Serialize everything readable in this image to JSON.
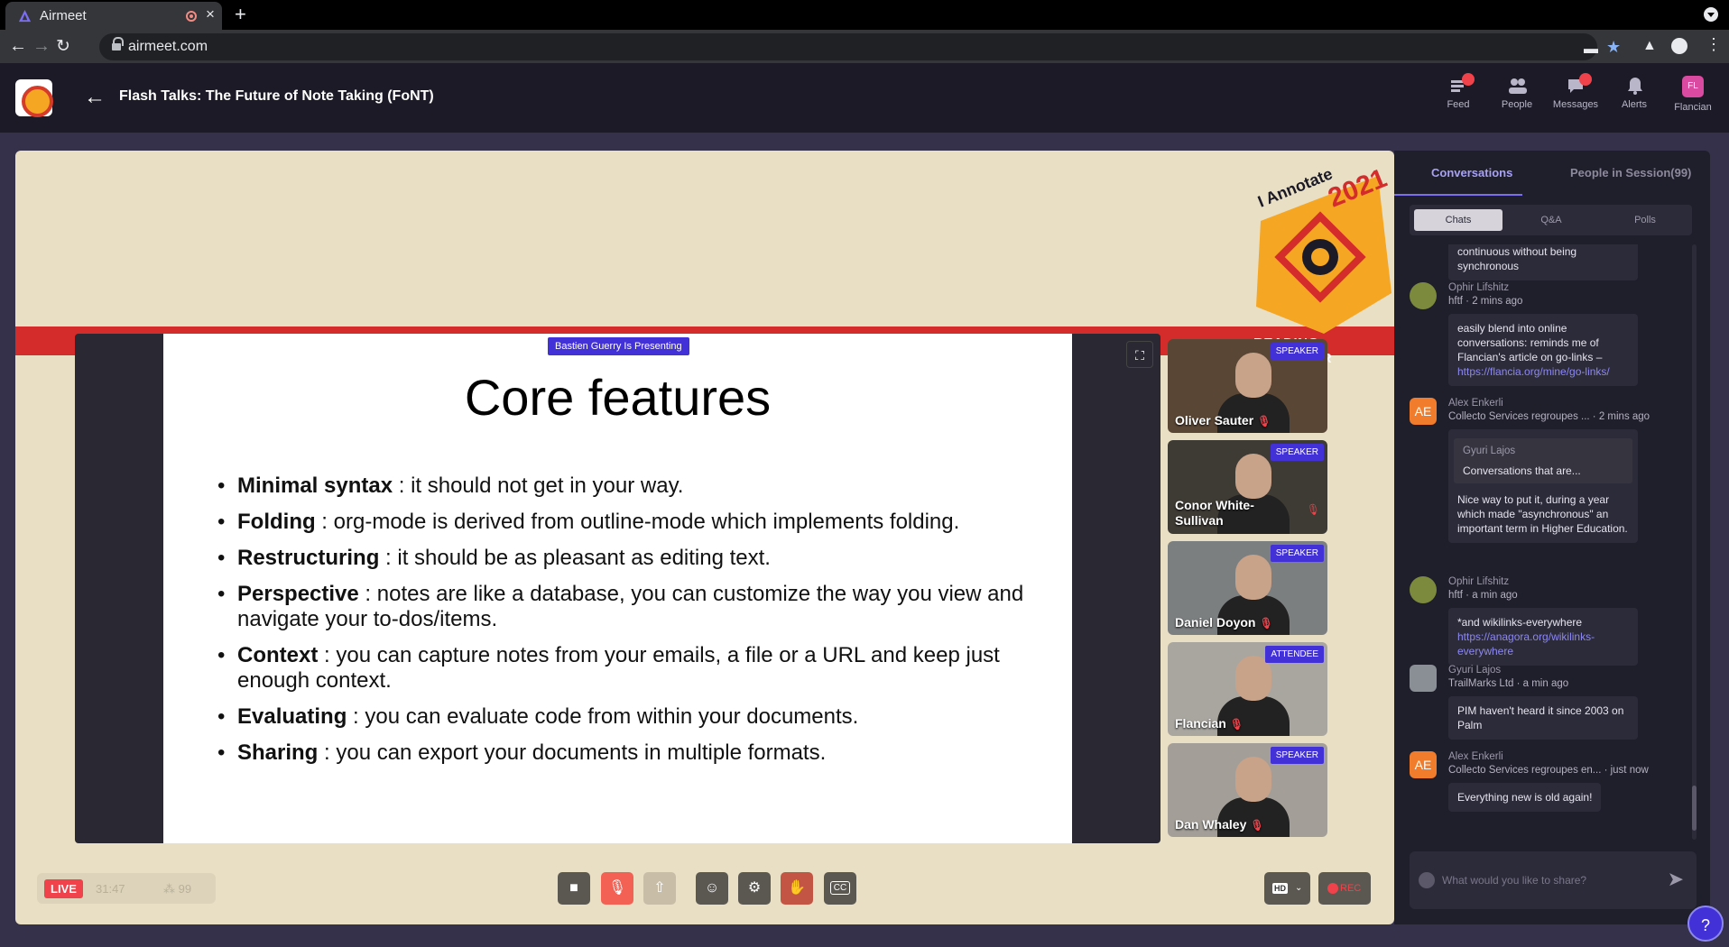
{
  "browser": {
    "tab_title": "Airmeet",
    "url": "airmeet.com"
  },
  "header": {
    "session_title": "Flash Talks: The Future of Note Taking (FoNT)",
    "nav": [
      {
        "label": "Feed",
        "icon": "feed-icon",
        "has_dot": true
      },
      {
        "label": "People",
        "icon": "people-icon",
        "has_dot": false
      },
      {
        "label": "Messages",
        "icon": "messages-icon",
        "has_dot": true
      },
      {
        "label": "Alerts",
        "icon": "bell-icon",
        "has_dot": false
      },
      {
        "label": "Flancian",
        "icon": "avatar",
        "has_dot": false
      }
    ],
    "user_initials": "FL"
  },
  "stage": {
    "banner_badge": "I Annotate 2021",
    "banner_text": "READING TOGETHER",
    "presenting_label": "Bastien Guerry Is Presenting",
    "slide": {
      "title": "Core features",
      "bullets": [
        {
          "term": "Minimal syntax",
          "text": " : it should not get in your way."
        },
        {
          "term": "Folding",
          "text": " : org-mode is derived from outline-mode which implements folding."
        },
        {
          "term": "Restructuring",
          "text": " : it should be as pleasant as editing text."
        },
        {
          "term": "Perspective",
          "text": " : notes are like a database, you can customize the way you view and navigate your to-dos/items."
        },
        {
          "term": "Context",
          "text": " : you can capture notes from your emails, a file or a URL and keep just enough context."
        },
        {
          "term": "Evaluating",
          "text": " : you can evaluate code from within your documents."
        },
        {
          "term": "Sharing",
          "text": " : you can export your documents in multiple formats."
        }
      ]
    },
    "tiles": [
      {
        "name": "Oliver Sauter",
        "role": "SPEAKER",
        "bg": "#5a4634"
      },
      {
        "name": "Conor White-Sullivan",
        "role": "SPEAKER",
        "bg": "#3e3a34"
      },
      {
        "name": "Daniel Doyon",
        "role": "SPEAKER",
        "bg": "#7c7f80"
      },
      {
        "name": "Flancian",
        "role": "ATTENDEE",
        "bg": "#a9a6a0"
      },
      {
        "name": "Dan Whaley",
        "role": "SPEAKER",
        "bg": "#a39f98"
      }
    ]
  },
  "controls": {
    "live_label": "LIVE",
    "timer": "31:47",
    "attendee_count": "99",
    "hd_label": "HD",
    "rec_label": "REC"
  },
  "panel": {
    "tabs": [
      "Conversations",
      "People in Session(99)"
    ],
    "subtabs": [
      "Chats",
      "Q&A",
      "Polls"
    ],
    "messages": [
      {
        "partial_text": "continuous without being synchronous"
      },
      {
        "author": "Ophir Lifshitz",
        "meta": "hftf · 2 mins ago",
        "text": "easily blend into online conversations: reminds me of Flancian's article on go-links – ",
        "link": "https://flancia.org/mine/go-links/"
      },
      {
        "author": "Alex Enkerli",
        "meta": "Collecto Services regroupes ...  · 2 mins ago",
        "initials": "AE",
        "quote_author": "Gyuri Lajos",
        "quote_text": "Conversations that are...",
        "text": "Nice way to put it, during a year which made \"asynchronous\" an important term in Higher Education."
      },
      {
        "author": "Ophir Lifshitz",
        "meta": "hftf · a min ago",
        "text": "*and wikilinks-everywhere ",
        "link": "https://anagora.org/wikilinks-everywhere"
      },
      {
        "author": "Gyuri Lajos",
        "meta": "TrailMarks Ltd  · a min ago",
        "text": "PIM haven't heard it since 2003 on Palm"
      },
      {
        "author": "Alex Enkerli",
        "meta": "Collecto Services regroupes en...  · just now",
        "initials": "AE",
        "text": "Everything new is old again!"
      }
    ],
    "composer_placeholder": "What would you like to share?"
  },
  "colors": {
    "accent": "#4331d8",
    "live_red": "#f0424a",
    "stage_bg": "#e9dfc5"
  }
}
